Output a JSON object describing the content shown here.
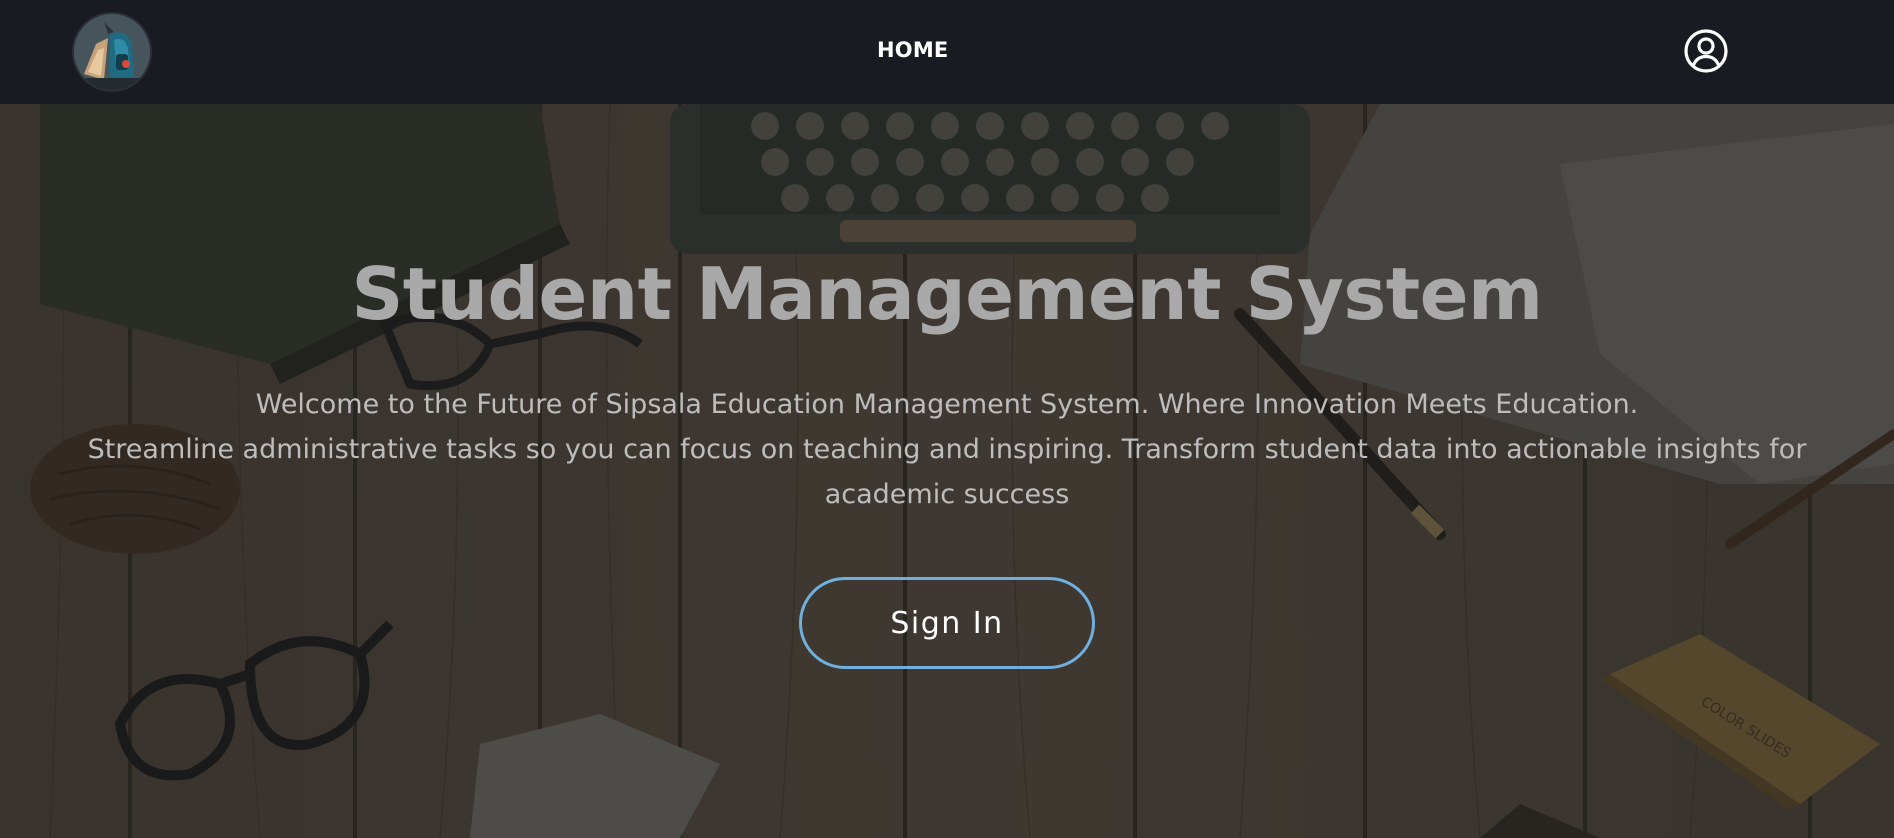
{
  "navbar": {
    "logo_icon": "school-backpack-logo-icon",
    "home_label": "HOME",
    "user_icon": "user-circle-icon"
  },
  "hero": {
    "title": "Student Management System",
    "line1": "Welcome to the Future of Sipsala Education Management System. Where Innovation Meets Education.",
    "line2": "Streamline administrative tasks so you can focus on teaching and inspiring. Transform student data into actionable insights for",
    "line3": "academic success",
    "signin_label": "Sign In",
    "background_image": "wooden-desk-typewriter-glasses-notebook",
    "notebook_text": "COLOR SLIDES"
  },
  "colors": {
    "navbar_bg": "#181b21",
    "title": "#a9a9a9",
    "body_text": "#bdbdbd",
    "button_border": "#6fb0de",
    "button_text": "#ffffff"
  }
}
